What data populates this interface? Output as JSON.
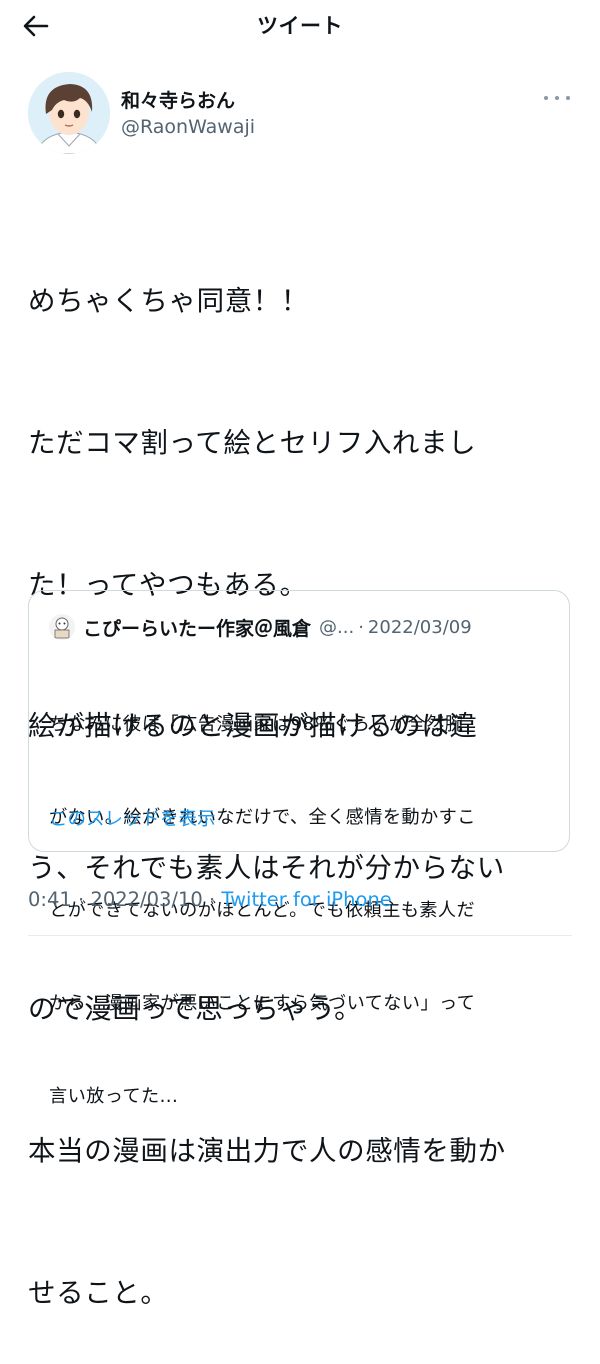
{
  "header": {
    "title": "ツイート",
    "back_icon": "arrow-left-icon"
  },
  "author": {
    "name": "和々寺らおん",
    "handle": "@RaonWawaji",
    "more_icon": "more-dots-icon"
  },
  "tweet": {
    "lines": [
      "めちゃくちゃ同意！！",
      "ただコマ割って絵とセリフ入れまし",
      "た！ってやつもある。",
      "絵が描けるのと漫画が描けるのは違",
      "う、それでも素人はそれが分からない",
      "ので漫画って思っちゃう。",
      "本当の漫画は演出力で人の感情を動か",
      "せること。"
    ]
  },
  "quote": {
    "name": "こぴーらいたー作家＠風倉",
    "handle": "@...",
    "separator": "·",
    "date": "2022/03/09",
    "lines": [
      "ちなみに彼は「広告漫画家は98％ぐらいが全然腕",
      "がない。絵がきれいなだけで、全く感情を動かすこ",
      "とができてないのがほとんど。でも依頼主も素人だ",
      "から、漫画家が悪いことにすら気づいてない」って",
      "言い放ってた..."
    ],
    "thread_link": "このスレッドを表示"
  },
  "meta": {
    "time": "0:41",
    "sep1": " · ",
    "date": "2022/03/10",
    "sep2": " · ",
    "source": "Twitter for iPhone"
  },
  "colors": {
    "link": "#1d9bf0",
    "secondary": "#536471",
    "text": "#0f1419",
    "border": "#cfd9de"
  }
}
